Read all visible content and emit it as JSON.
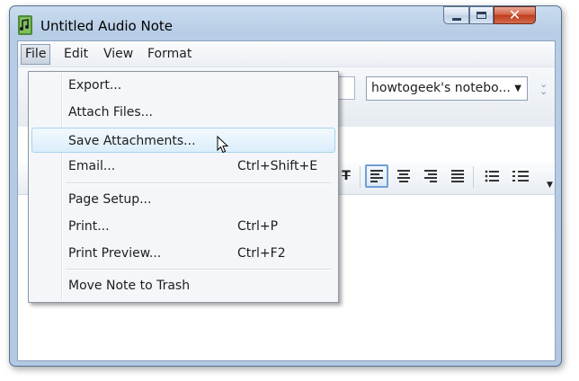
{
  "window": {
    "title": "Untitled Audio Note"
  },
  "menubar": {
    "items": [
      "File",
      "Edit",
      "View",
      "Format"
    ]
  },
  "toolbar": {
    "notebook_selected": "howtogeek's notebo..."
  },
  "file_menu": {
    "items": [
      {
        "label": "Export...",
        "shortcut": ""
      },
      {
        "label": "Attach Files...",
        "shortcut": ""
      },
      {
        "label": "Save Attachments...",
        "shortcut": ""
      },
      {
        "label": "Email...",
        "shortcut": "Ctrl+Shift+E"
      },
      {
        "label": "Page Setup...",
        "shortcut": ""
      },
      {
        "label": "Print...",
        "shortcut": "Ctrl+P"
      },
      {
        "label": "Print Preview...",
        "shortcut": "Ctrl+F2"
      },
      {
        "label": "Move Note to Trash",
        "shortcut": ""
      }
    ]
  },
  "colors": {
    "menu_hover": "#dbeefb",
    "title_bar": "#b9cfe7",
    "close_button": "#c8472a"
  },
  "icons": [
    "app-icon",
    "minimize-icon",
    "maximize-icon",
    "close-icon",
    "dropdown-arrow-icon",
    "collapse-icon",
    "strikethrough-icon",
    "align-left-icon",
    "align-center-icon",
    "align-right-icon",
    "justify-icon",
    "bulleted-list-icon",
    "numbered-list-icon",
    "mouse-cursor-icon"
  ]
}
